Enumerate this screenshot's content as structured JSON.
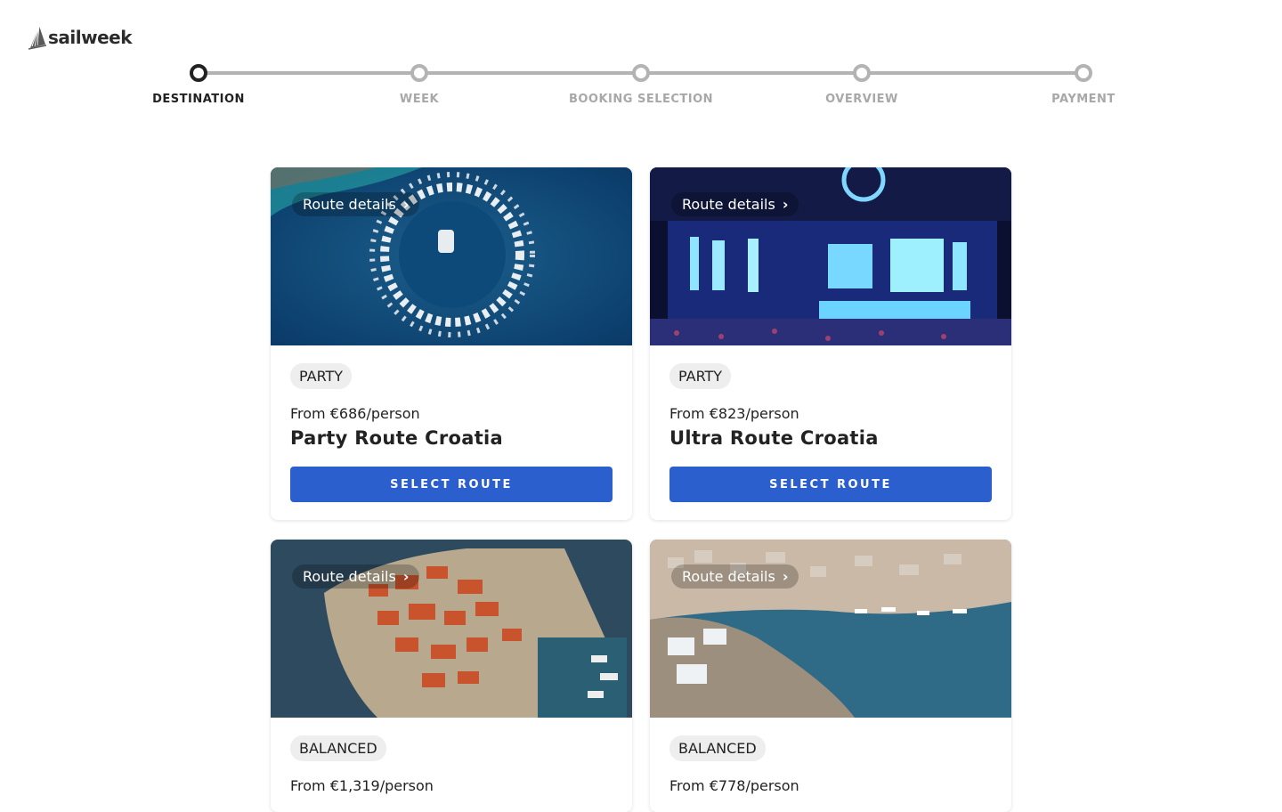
{
  "brand": {
    "name": "sailweek"
  },
  "stepper": {
    "steps": [
      {
        "label": "DESTINATION",
        "active": true
      },
      {
        "label": "WEEK",
        "active": false
      },
      {
        "label": "BOOKING SELECTION",
        "active": false
      },
      {
        "label": "OVERVIEW",
        "active": false
      },
      {
        "label": "PAYMENT",
        "active": false
      }
    ]
  },
  "routes": [
    {
      "details_label": "Route details",
      "chevron_icon": "chevron-right-icon",
      "badge": "PARTY",
      "price": "From €686/person",
      "title": "Party Route Croatia",
      "button": "SELECT ROUTE",
      "image": "boats-circle-aerial"
    },
    {
      "details_label": "Route details",
      "chevron_icon": "chevron-right-icon",
      "badge": "PARTY",
      "price": "From €823/person",
      "title": "Ultra Route Croatia",
      "button": "SELECT ROUTE",
      "image": "concert-stage"
    },
    {
      "details_label": "Route details",
      "chevron_icon": "chevron-right-icon",
      "badge": "BALANCED",
      "price": "From €1,319/person",
      "title": "",
      "button": "",
      "image": "old-town-peninsula"
    },
    {
      "details_label": "Route details",
      "chevron_icon": "chevron-right-icon",
      "badge": "BALANCED",
      "price": "From €778/person",
      "title": "",
      "button": "",
      "image": "harbor-town"
    }
  ],
  "colors": {
    "primary_button": "#2a5fcd",
    "active_step": "#222222",
    "inactive_step": "#b3b3b3"
  }
}
